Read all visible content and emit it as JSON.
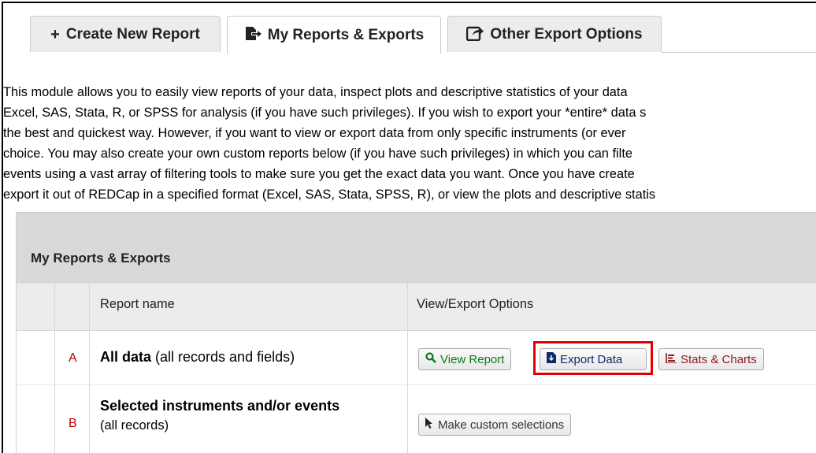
{
  "tabs": [
    {
      "label": "Create New Report",
      "icon": "plus-icon",
      "glyph": "+"
    },
    {
      "label": "My Reports & Exports",
      "icon": "file-export-icon",
      "glyph": "▶"
    },
    {
      "label": "Other Export Options",
      "icon": "share-icon",
      "glyph": "↗"
    }
  ],
  "description": [
    "This module allows you to easily view reports of your data, inspect plots and descriptive statistics of your data",
    "Excel, SAS, Stata, R, or SPSS for analysis (if you have such privileges). If you wish to export your *entire* data s",
    "the best and quickest way. However, if you want to view or export data from only specific instruments (or ever",
    "choice. You may also create your own custom reports below (if you have such privileges) in which you can filte",
    "events using a vast array of filtering tools to make sure you get the exact data you want. Once you have create",
    "export it out of REDCap in a specified format (Excel, SAS, Stata, SPSS, R), or view the plots and descriptive statis"
  ],
  "table": {
    "title": "My Reports & Exports",
    "col_report_name": "Report name",
    "col_options": "View/Export Options",
    "rows": [
      {
        "letter": "A",
        "name_bold": "All data",
        "name_rest": " (all records and fields)"
      },
      {
        "letter": "B",
        "name_bold": "Selected instruments and/or events",
        "name_rest": "(all records)"
      }
    ]
  },
  "buttons": {
    "view_report": "View Report",
    "export_data": "Export Data",
    "stats_charts": "Stats & Charts",
    "make_custom": "Make custom selections"
  },
  "colors": {
    "highlight": "#e00000",
    "letter": "#c00000",
    "view_green": "#0a7a1a",
    "stats_red": "#8b1a1a"
  }
}
